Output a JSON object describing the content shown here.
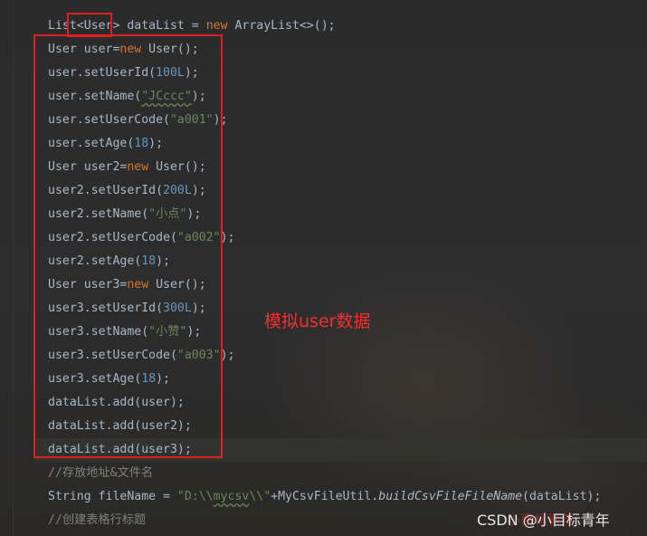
{
  "code": {
    "line1": {
      "a": "List",
      "b": "<User>",
      "c": " dataList = ",
      "kw": "new",
      "d": " ArrayList<>();"
    },
    "line2": {
      "a": "User user=",
      "kw": "new",
      "b": " User();"
    },
    "line3": {
      "a": "user.setUserId(",
      "num": "100L",
      "b": ");"
    },
    "line4": {
      "a": "user.setName(",
      "str": "\"JCccc\"",
      "b": ");"
    },
    "line5": {
      "a": "user.setUserCode(",
      "str": "\"a001\"",
      "b": ");"
    },
    "line6": {
      "a": "user.setAge(",
      "num": "18",
      "b": ");"
    },
    "line7": {
      "a": "User user2=",
      "kw": "new",
      "b": " User();"
    },
    "line8": {
      "a": "user2.setUserId(",
      "num": "200L",
      "b": ");"
    },
    "line9": {
      "a": "user2.setName(",
      "str": "\"小点\"",
      "b": ");"
    },
    "line10": {
      "a": "user2.setUserCode(",
      "str": "\"a002\"",
      "b": ");"
    },
    "line11": {
      "a": "user2.setAge(",
      "num": "18",
      "b": ");"
    },
    "line12": {
      "a": "User user3=",
      "kw": "new",
      "b": " User();"
    },
    "line13": {
      "a": "user3.setUserId(",
      "num": "300L",
      "b": ");"
    },
    "line14": {
      "a": "user3.setName(",
      "str": "\"小赞\"",
      "b": ");"
    },
    "line15": {
      "a": "user3.setUserCode(",
      "str": "\"a003\"",
      "b": ");"
    },
    "line16": {
      "a": "user3.setAge(",
      "num": "18",
      "b": ");"
    },
    "line17": {
      "a": "dataList.add(user);"
    },
    "line18": {
      "a": "dataList.add(user2);"
    },
    "line19": {
      "a": "dataList.add(user3);"
    },
    "line20": {
      "cm": "//存放地址&文件名"
    },
    "line21": {
      "a": "String fileName = ",
      "s1": "\"D:\\\\",
      "s2": "mycsv",
      "s3": "\\\\\"",
      "b": "+MyCsvFileUtil.",
      "m": "buildCsvFileFileName",
      "c": "(dataList);"
    },
    "line22": {
      "cm": "//创建表格行标题"
    }
  },
  "annotation": {
    "text": "模拟user数据"
  },
  "watermark": {
    "text": "CSDN @小目标青年",
    "overlay": "小目标青年"
  },
  "colors": {
    "keyword": "#cc7832",
    "number": "#6897bb",
    "string": "#6a8759",
    "comment": "#808080",
    "text": "#a9b7c6",
    "highlight_box": "#e02020"
  }
}
